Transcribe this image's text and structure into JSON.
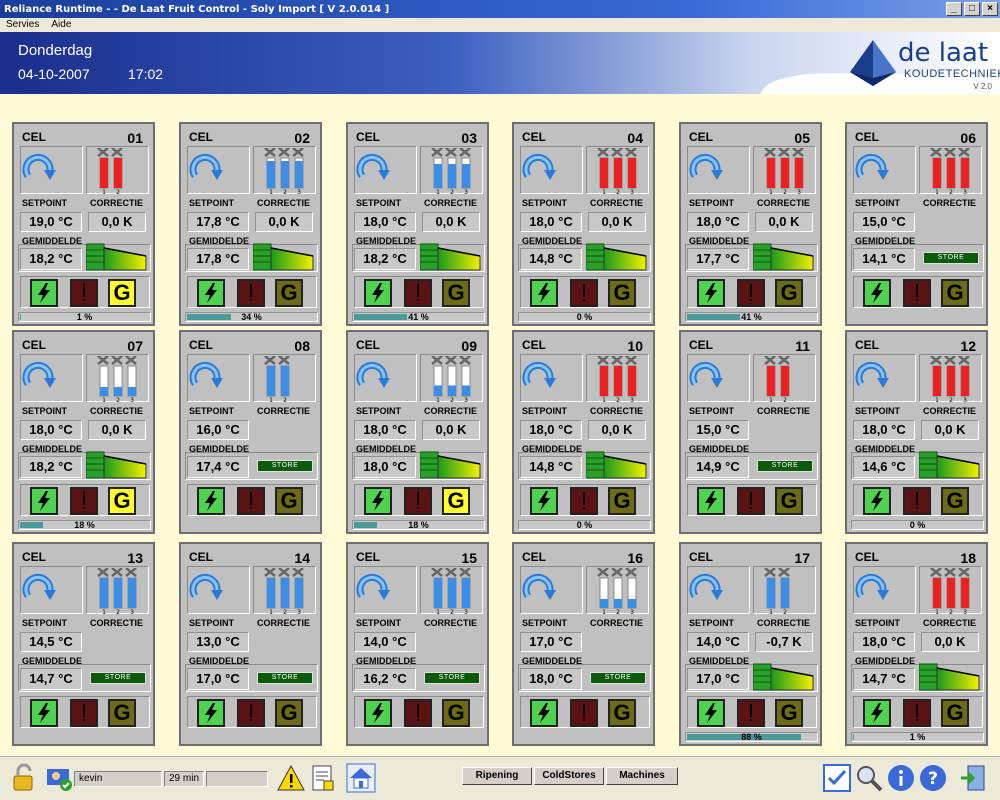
{
  "window": {
    "title": "Reliance Runtime -  - De Laat Fruit Control - Soly Import     [ V 2.0.014 ]"
  },
  "menu": [
    "Servies",
    "Aide"
  ],
  "header": {
    "day": "Donderdag",
    "date": "04-10-2007",
    "time": "17:02",
    "brand": "de laat",
    "brand_sub": "KOUDETECHNIEK",
    "brand_ver": "V 2.0"
  },
  "labels": {
    "cel": "CEL",
    "setpoint": "SETPOINT",
    "correctie": "CORRECTIE",
    "gemiddelde": "GEMIDDELDE",
    "store": "STORE"
  },
  "colors": {
    "accent": "#1b3e8a",
    "btn_green": "#4fd24f",
    "btn_red": "#5a1212",
    "g_active": "#ffff30",
    "g_inactive": "#6b6b18",
    "progress": "#4a9a9a"
  },
  "cells": [
    {
      "num": "01",
      "setpoint": "19,0 °C",
      "correctie": "0,0 K",
      "gem": "18,2 °C",
      "fans": [
        "red",
        "red"
      ],
      "fan_fill": [
        1,
        1
      ],
      "mode": "graph",
      "g_active": true,
      "pct": 0.01,
      "pct_text": "1 %",
      "show_prog": true
    },
    {
      "num": "02",
      "setpoint": "17,8 °C",
      "correctie": "0,0 K",
      "gem": "17,8 °C",
      "fans": [
        "blue",
        "blue",
        "blue"
      ],
      "fan_fill": [
        0.9,
        0.9,
        0.9
      ],
      "mode": "graph",
      "g_active": false,
      "pct": 0.34,
      "pct_text": "34 %",
      "show_prog": true
    },
    {
      "num": "03",
      "setpoint": "18,0 °C",
      "correctie": "0,0 K",
      "gem": "18,2 °C",
      "fans": [
        "blue",
        "blue",
        "blue"
      ],
      "fan_fill": [
        0.8,
        0.8,
        0.8
      ],
      "mode": "graph",
      "g_active": false,
      "pct": 0.41,
      "pct_text": "41 %",
      "show_prog": true
    },
    {
      "num": "04",
      "setpoint": "18,0 °C",
      "correctie": "0,0 K",
      "gem": "14,8 °C",
      "fans": [
        "red",
        "red",
        "red"
      ],
      "fan_fill": [
        1,
        1,
        1
      ],
      "mode": "graph",
      "g_active": false,
      "pct": 0,
      "pct_text": "0 %",
      "show_prog": true
    },
    {
      "num": "05",
      "setpoint": "18,0 °C",
      "correctie": "0,0 K",
      "gem": "17,7 °C",
      "fans": [
        "red",
        "red",
        "red"
      ],
      "fan_fill": [
        1,
        1,
        1
      ],
      "mode": "graph",
      "g_active": false,
      "pct": 0.41,
      "pct_text": "41 %",
      "show_prog": true
    },
    {
      "num": "06",
      "setpoint": "15,0 °C",
      "correctie": "",
      "gem": "14,1 °C",
      "fans": [
        "red",
        "red",
        "red"
      ],
      "fan_fill": [
        1,
        1,
        1
      ],
      "mode": "store",
      "g_active": false,
      "pct": 0,
      "pct_text": "",
      "show_prog": false
    },
    {
      "num": "07",
      "setpoint": "18,0 °C",
      "correctie": "0,0 K",
      "gem": "18,2 °C",
      "fans": [
        "blue",
        "blue",
        "blue"
      ],
      "fan_fill": [
        0.3,
        0.3,
        0.3
      ],
      "mode": "graph",
      "g_active": true,
      "pct": 0.18,
      "pct_text": "18 %",
      "show_prog": true
    },
    {
      "num": "08",
      "setpoint": "16,0 °C",
      "correctie": "",
      "gem": "17,4 °C",
      "fans": [
        "blue",
        "blue"
      ],
      "fan_fill": [
        1,
        1
      ],
      "mode": "store",
      "g_active": false,
      "pct": 0,
      "pct_text": "",
      "show_prog": false
    },
    {
      "num": "09",
      "setpoint": "18,0 °C",
      "correctie": "0,0 K",
      "gem": "18,0 °C",
      "fans": [
        "blue",
        "blue",
        "blue"
      ],
      "fan_fill": [
        0.35,
        0.35,
        0.35
      ],
      "mode": "graph",
      "g_active": true,
      "pct": 0.18,
      "pct_text": "18 %",
      "show_prog": true
    },
    {
      "num": "10",
      "setpoint": "18,0 °C",
      "correctie": "0,0 K",
      "gem": "14,8 °C",
      "fans": [
        "red",
        "red",
        "red"
      ],
      "fan_fill": [
        1,
        1,
        1
      ],
      "mode": "graph",
      "g_active": false,
      "pct": 0,
      "pct_text": "0 %",
      "show_prog": true
    },
    {
      "num": "11",
      "setpoint": "15,0 °C",
      "correctie": "",
      "gem": "14,9 °C",
      "fans": [
        "red",
        "red"
      ],
      "fan_fill": [
        1,
        1
      ],
      "mode": "store",
      "g_active": false,
      "pct": 0,
      "pct_text": "",
      "show_prog": false
    },
    {
      "num": "12",
      "setpoint": "18,0 °C",
      "correctie": "0,0 K",
      "gem": "14,6 °C",
      "fans": [
        "red",
        "red",
        "red"
      ],
      "fan_fill": [
        1,
        1,
        1
      ],
      "mode": "graph",
      "g_active": false,
      "pct": 0,
      "pct_text": "0 %",
      "show_prog": true
    },
    {
      "num": "13",
      "setpoint": "14,5 °C",
      "correctie": "",
      "gem": "14,7 °C",
      "fans": [
        "blue",
        "blue",
        "blue"
      ],
      "fan_fill": [
        1,
        1,
        1
      ],
      "mode": "store",
      "g_active": false,
      "pct": 0,
      "pct_text": "",
      "show_prog": false
    },
    {
      "num": "14",
      "setpoint": "13,0 °C",
      "correctie": "",
      "gem": "17,0 °C",
      "fans": [
        "blue",
        "blue",
        "blue"
      ],
      "fan_fill": [
        1,
        1,
        1
      ],
      "mode": "store",
      "g_active": false,
      "pct": 0,
      "pct_text": "",
      "show_prog": false
    },
    {
      "num": "15",
      "setpoint": "14,0 °C",
      "correctie": "",
      "gem": "16,2 °C",
      "fans": [
        "blue",
        "blue",
        "blue"
      ],
      "fan_fill": [
        1,
        1,
        1
      ],
      "mode": "store",
      "g_active": false,
      "pct": 0,
      "pct_text": "",
      "show_prog": false
    },
    {
      "num": "16",
      "setpoint": "17,0 °C",
      "correctie": "",
      "gem": "18,0 °C",
      "fans": [
        "blue",
        "blue",
        "blue"
      ],
      "fan_fill": [
        0.3,
        0.3,
        0.3
      ],
      "mode": "store",
      "g_active": false,
      "pct": 0,
      "pct_text": "",
      "show_prog": false
    },
    {
      "num": "17",
      "setpoint": "14,0 °C",
      "correctie": "-0,7 K",
      "gem": "17,0 °C",
      "fans": [
        "blue",
        "blue"
      ],
      "fan_fill": [
        1,
        1
      ],
      "mode": "graph",
      "g_active": false,
      "pct": 0.88,
      "pct_text": "88 %",
      "show_prog": true
    },
    {
      "num": "18",
      "setpoint": "18,0 °C",
      "correctie": "0,0 K",
      "gem": "14,7 °C",
      "fans": [
        "red",
        "red",
        "red"
      ],
      "fan_fill": [
        1,
        1,
        1
      ],
      "mode": "graph",
      "g_active": false,
      "pct": 0.01,
      "pct_text": "1 %",
      "show_prog": true
    }
  ],
  "statusbar": {
    "user": "kevin",
    "uptime": "29 min",
    "nav": [
      "Ripening",
      "ColdStores",
      "Machines"
    ],
    "icons_left": [
      "padlock-icon",
      "user-icon",
      "warning-icon",
      "report-icon",
      "home-icon"
    ],
    "icons_right": [
      "checklist-icon",
      "search-icon",
      "info-icon",
      "help-icon",
      "exit-icon"
    ]
  }
}
